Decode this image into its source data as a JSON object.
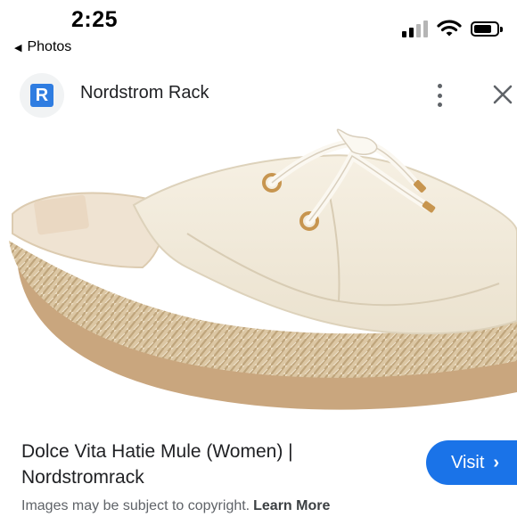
{
  "status_bar": {
    "time": "2:25",
    "back_label": "Photos",
    "icons": [
      "cellular-signal-icon",
      "wifi-icon",
      "battery-icon"
    ]
  },
  "source": {
    "logo_letter": "R",
    "site_name": "Nordstrom Rack",
    "logo_color": "#2f7de1",
    "icons": [
      "more-vert-icon",
      "close-icon"
    ]
  },
  "product": {
    "title": "Dolce Vita Hatie Mule (Women) | Nordstromrack",
    "visit_label": "Visit",
    "visit_color": "#1a73e8"
  },
  "footer": {
    "copyright_text": "Images may be subject to copyright.",
    "learn_more": "Learn More"
  }
}
